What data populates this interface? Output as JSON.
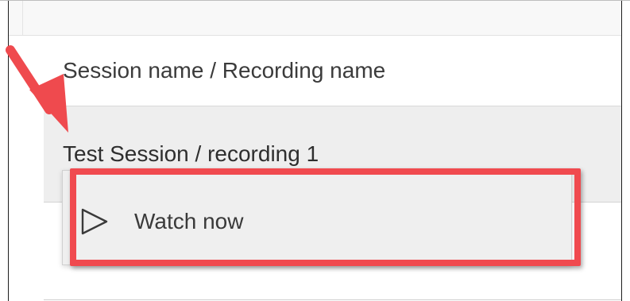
{
  "table": {
    "header_label": "Session name / Recording name",
    "selected_row_label": "Test Session / recording 1"
  },
  "context_menu": {
    "items": [
      {
        "label": "Watch now",
        "icon": "play-icon"
      }
    ]
  },
  "annotation": {
    "arrow_color": "#ef4a4e",
    "highlight_color": "#f04a4f",
    "arrow_icon": "arrow-icon"
  }
}
